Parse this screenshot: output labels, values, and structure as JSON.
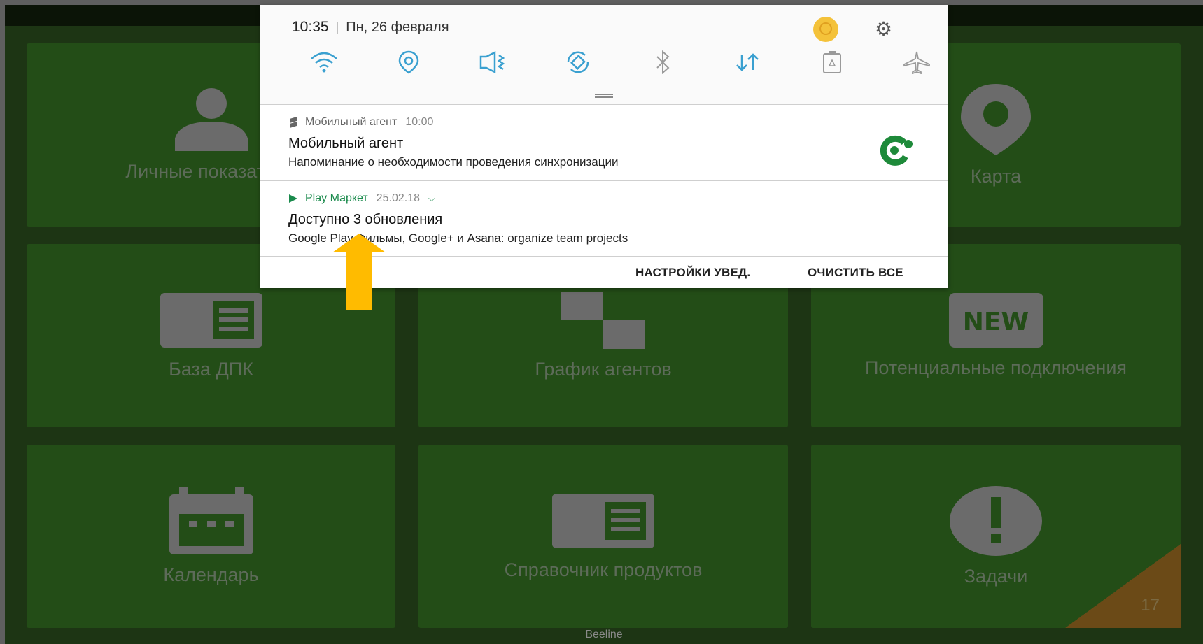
{
  "status_shade": {
    "time": "10:35",
    "separator": "|",
    "date": "Пн, 26 февраля",
    "quick_settings": [
      "wifi-icon",
      "location-icon",
      "sound-mute-icon",
      "auto-rotate-icon",
      "bluetooth-icon",
      "mobile-data-icon",
      "power-saving-icon",
      "airplane-mode-icon"
    ]
  },
  "notifications": [
    {
      "app": "Мобильный агент",
      "time": "10:00",
      "title": "Мобильный агент",
      "body": "Напоминание о необходимости проведения синхронизации"
    },
    {
      "app": "Play Маркет",
      "time": "25.02.18",
      "title": "Доступно 3 обновления",
      "body": "Google Play Фильмы, Google+ и Asana: organize team projects"
    }
  ],
  "actions": {
    "settings": "НАСТРОЙКИ УВЕД.",
    "clear_all": "ОЧИСТИТЬ ВСЕ"
  },
  "tiles": {
    "personal": "Личные показатели",
    "map": "Карта",
    "dpk": "База ДПК",
    "schedule": "График агентов",
    "potential": "Потенциальные подключения",
    "new_badge": "NEW",
    "calendar": "Календарь",
    "products": "Справочник продуктов",
    "tasks": "Задачи",
    "tasks_count": "17"
  },
  "carrier": "Beeline",
  "colors": {
    "tile": "#234d17",
    "background": "#1d3514",
    "accent_arrow": "#ffbb00",
    "play_green": "#1a8a4c"
  }
}
